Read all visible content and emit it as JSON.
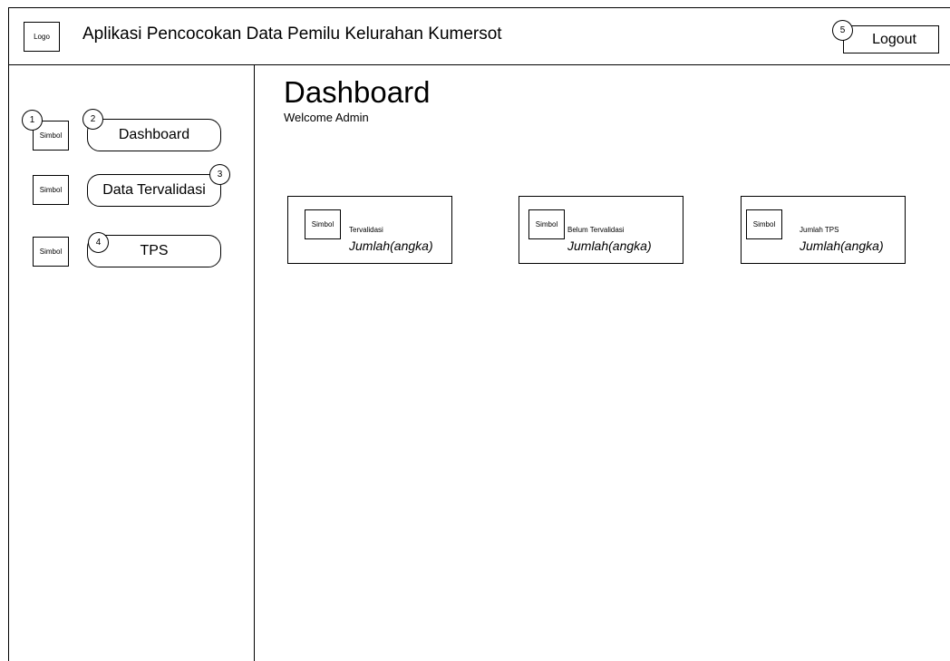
{
  "header": {
    "logo_text": "Logo",
    "app_title": "Aplikasi Pencocokan Data Pemilu Kelurahan Kumersot",
    "logout_label": "Logout",
    "logout_marker": "5"
  },
  "sidebar": {
    "items": [
      {
        "symbol": "Simbol",
        "label": "Dashboard",
        "symbol_marker": "1",
        "label_marker": "2"
      },
      {
        "symbol": "Simbol",
        "label": "Data Tervalidasi",
        "label_marker": "3"
      },
      {
        "symbol": "Simbol",
        "label": "TPS",
        "label_marker": "4"
      }
    ]
  },
  "main": {
    "title": "Dashboard",
    "welcome": "Welcome Admin",
    "cards": [
      {
        "symbol": "Simbol",
        "label": "Tervalidasi",
        "value": "Jumlah(angka)"
      },
      {
        "symbol": "Simbol",
        "label": "Belum Tervalidasi",
        "value": "Jumlah(angka)"
      },
      {
        "symbol": "Simbol",
        "label": "Jumlah TPS",
        "value": "Jumlah(angka)"
      }
    ]
  }
}
